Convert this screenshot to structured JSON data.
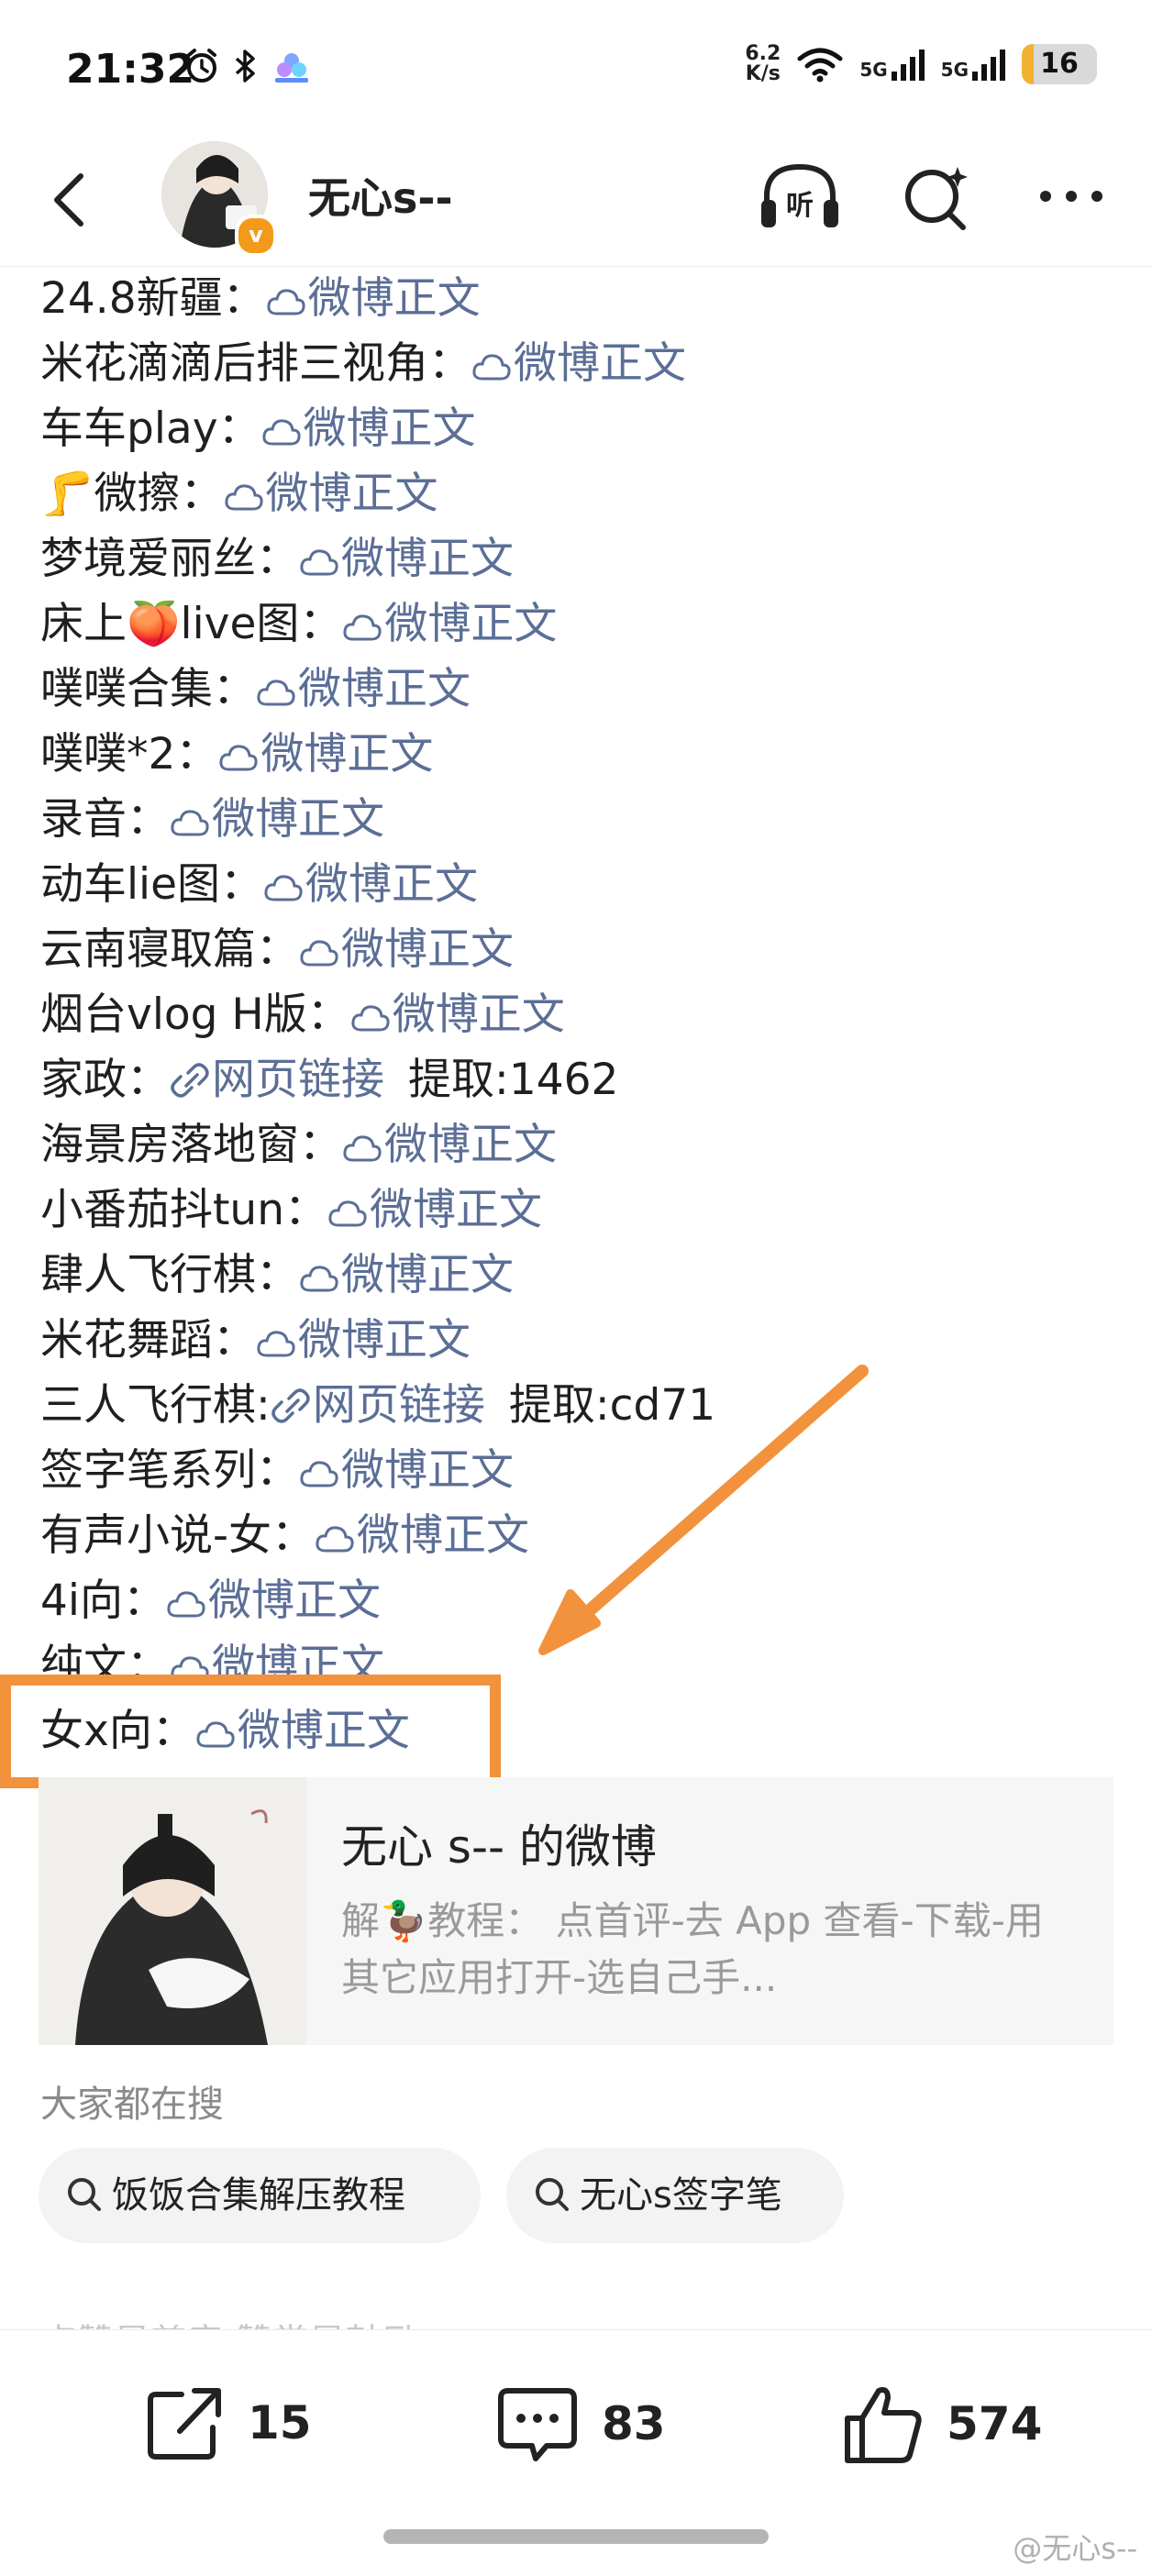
{
  "status_bar": {
    "time": "21:32",
    "net_speed_value": "6.2",
    "net_speed_unit": "K/s",
    "signal1": "5G",
    "signal2": "5G",
    "battery": "16",
    "icons": [
      "alarm-icon",
      "bluetooth-icon",
      "app-icon",
      "wifi-icon",
      "signal-icon"
    ]
  },
  "header": {
    "username": "无心s--",
    "badge": "v",
    "icons": [
      "back-icon",
      "listen-icon",
      "search-icon",
      "more-icon"
    ],
    "listen_label": "听"
  },
  "post": {
    "lines": [
      {
        "label": "24.8新疆：",
        "link": "微博正文",
        "type": "weibo"
      },
      {
        "label": "米花滴滴后排三视角：",
        "link": "微博正文",
        "type": "weibo"
      },
      {
        "label": "车车play：",
        "link": "微博正文",
        "type": "weibo"
      },
      {
        "label": "🦵微擦：",
        "link": "微博正文",
        "type": "weibo"
      },
      {
        "label": "梦境爱丽丝：",
        "link": "微博正文",
        "type": "weibo"
      },
      {
        "label": "床上🍑live图：",
        "link": "微博正文",
        "type": "weibo"
      },
      {
        "label": "噗噗合集：",
        "link": "微博正文",
        "type": "weibo"
      },
      {
        "label": "噗噗*2：",
        "link": "微博正文",
        "type": "weibo"
      },
      {
        "label": "录音：",
        "link": "微博正文",
        "type": "weibo"
      },
      {
        "label": "动车lie图：",
        "link": "微博正文",
        "type": "weibo"
      },
      {
        "label": "云南寝取篇：",
        "link": "微博正文",
        "type": "weibo"
      },
      {
        "label": "烟台vlog H版：",
        "link": "微博正文",
        "type": "weibo"
      },
      {
        "label": "家政：",
        "link": "网页链接",
        "type": "web",
        "extra": "提取:1462"
      },
      {
        "label": "海景房落地窗：",
        "link": "微博正文",
        "type": "weibo"
      },
      {
        "label": "小番茄抖tun：",
        "link": "微博正文",
        "type": "weibo"
      },
      {
        "label": "肆人飞行棋：",
        "link": "微博正文",
        "type": "weibo"
      },
      {
        "label": "米花舞蹈：",
        "link": "微博正文",
        "type": "weibo"
      },
      {
        "label": "三人飞行棋:",
        "link": "网页链接",
        "type": "web",
        "extra": "提取:cd71"
      },
      {
        "label": "签字笔系列：",
        "link": "微博正文",
        "type": "weibo"
      },
      {
        "label": "有声小说-女：",
        "link": "微博正文",
        "type": "weibo"
      },
      {
        "label": "4i向：",
        "link": "微博正文",
        "type": "weibo"
      },
      {
        "label": "纯文：",
        "link": "微博正文",
        "type": "weibo"
      }
    ],
    "highlight": {
      "label": "女x向：",
      "link": "微博正文"
    }
  },
  "card": {
    "title": "无心 s-- 的微博",
    "desc": "解🦆教程：  点首评-去 App 查看-下载-用其它应用打开-选自己手..."
  },
  "search": {
    "heading": "大家都在搜",
    "chips": [
      "饭饭合集解压教程",
      "无心s签字笔"
    ]
  },
  "faded_text": "点赞是尊音 赞赏是鼓励",
  "actions": {
    "repost": "15",
    "comment": "83",
    "like": "574"
  },
  "watermark": "@无心s--",
  "colors": {
    "link": "#5b6e96",
    "highlight": "#f2923d",
    "badge": "#f39a1a"
  }
}
